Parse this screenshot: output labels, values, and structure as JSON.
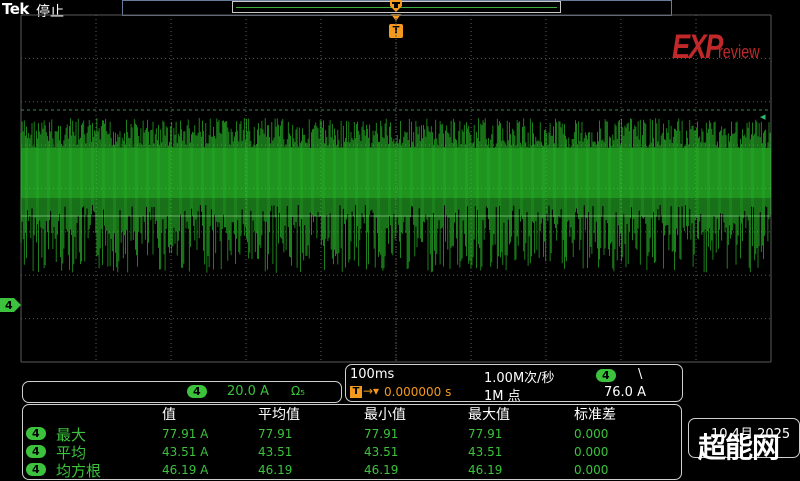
{
  "header": {
    "brand": "Tek",
    "status": "停止"
  },
  "trigger": {
    "badge": "T",
    "level_symbol": "◂"
  },
  "watermark": {
    "brand_main": "EXP",
    "brand_sub": "review",
    "site": "超能网"
  },
  "channel": {
    "number": "4",
    "scale": "20.0 A",
    "symbols": "Ω₅",
    "color": "#3cc23c"
  },
  "timebase": {
    "horizontal_scale": "100ms",
    "sample_rate": "1.00M次/秒",
    "trigger_label": "T",
    "trigger_arrow": "→▾",
    "trigger_position": "0.000000 s",
    "record_length": "1M 点",
    "trigger_channel": "4",
    "trigger_slope": "\\",
    "trigger_level": "76.0 A"
  },
  "measurements": {
    "headers": [
      "值",
      "平均值",
      "最小值",
      "最大值",
      "标准差"
    ],
    "rows": [
      {
        "channel": "4",
        "label": "最大",
        "values": [
          "77.91 A",
          "77.91",
          "77.91",
          "77.91",
          "0.000"
        ]
      },
      {
        "channel": "4",
        "label": "平均",
        "values": [
          "43.51 A",
          "43.51",
          "43.51",
          "43.51",
          "0.000"
        ]
      },
      {
        "channel": "4",
        "label": "均方根",
        "values": [
          "46.19 A",
          "46.19",
          "46.19",
          "46.19",
          "0.000"
        ]
      }
    ]
  },
  "datetime": "10 4月 2025",
  "colors": {
    "trace": "#2fd62f",
    "grid": "#5a5a5a",
    "trigger": "#f39a1e",
    "accent": "#3cc23c"
  }
}
